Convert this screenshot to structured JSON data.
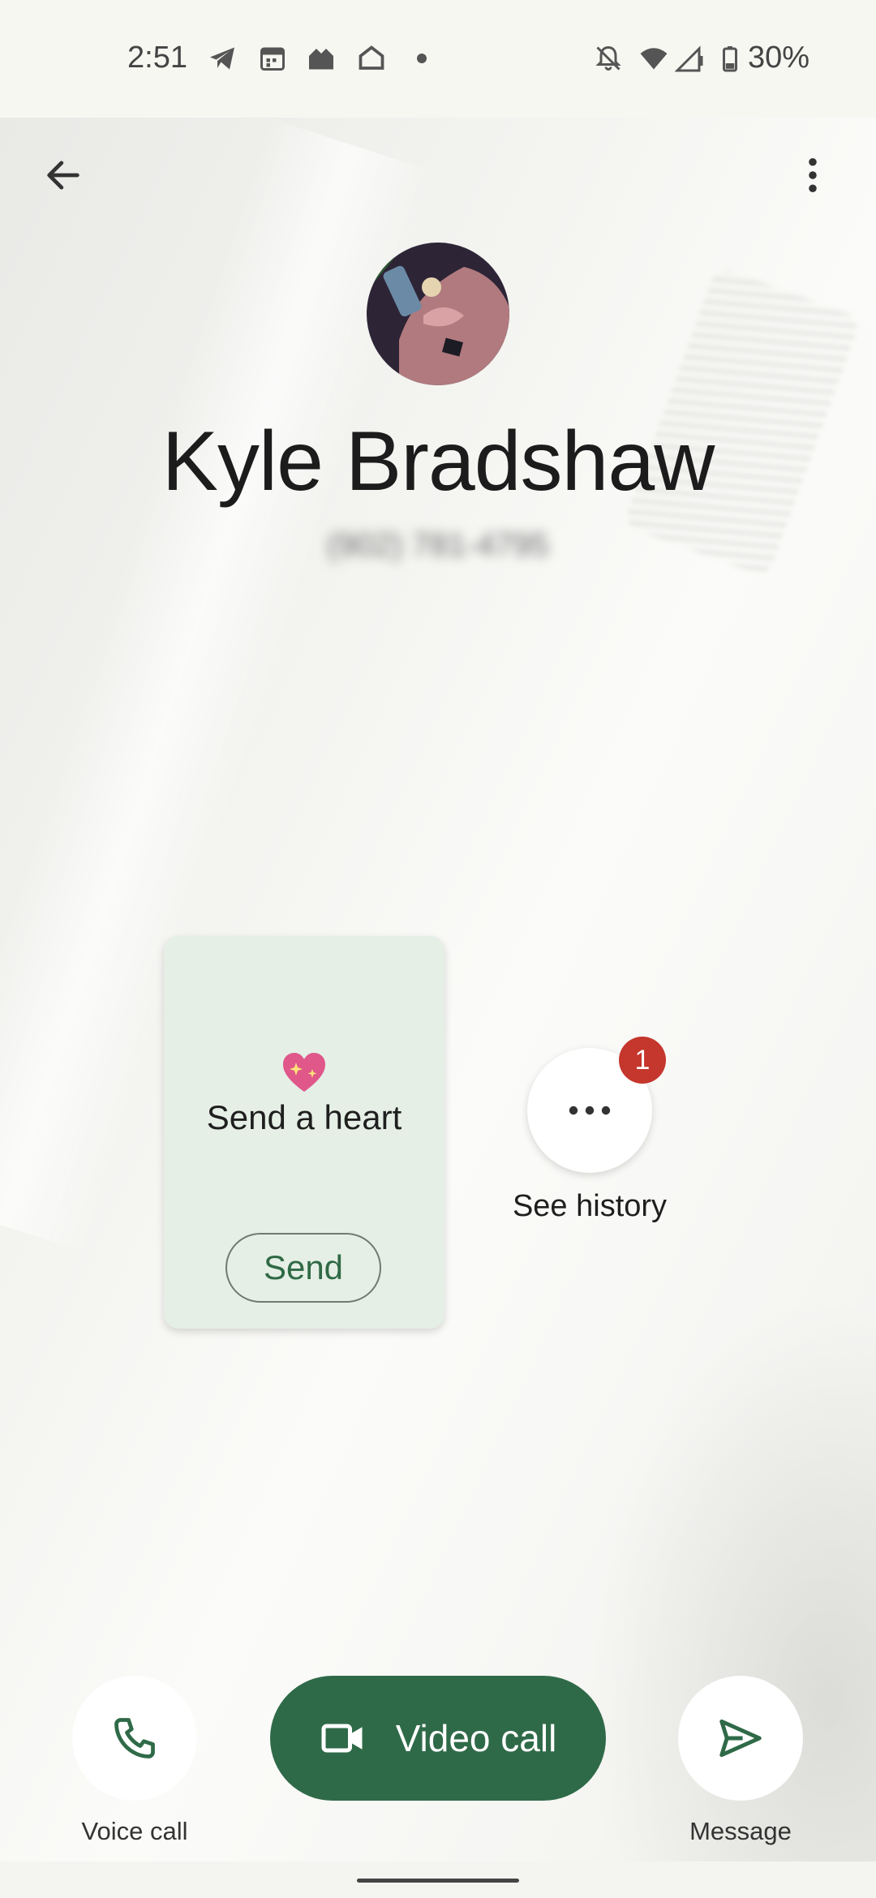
{
  "status_bar": {
    "time": "2:51",
    "battery_percent": "30%",
    "icons": [
      "telegram-icon",
      "calendar-icon",
      "google-home-icon",
      "home-icon",
      "dot-icon",
      "bell-off-icon",
      "wifi-icon",
      "cell-signal-icon",
      "battery-icon"
    ]
  },
  "top_bar": {
    "back_icon": "arrow-back-icon",
    "menu_icon": "more-vert-icon"
  },
  "contact": {
    "name": "Kyle Bradshaw",
    "number": "(902) 781-4795"
  },
  "heart_card": {
    "emoji": "sparkling-heart-icon",
    "title": "Send a heart",
    "button_label": "Send"
  },
  "history": {
    "label": "See history",
    "badge_count": "1",
    "icon": "more-horiz-icon"
  },
  "actions": {
    "voice_call_label": "Voice call",
    "video_call_label": "Video call",
    "message_label": "Message"
  },
  "colors": {
    "accent": "#2f6a48",
    "card_bg": "#e5efe6",
    "badge": "#c5362c"
  }
}
